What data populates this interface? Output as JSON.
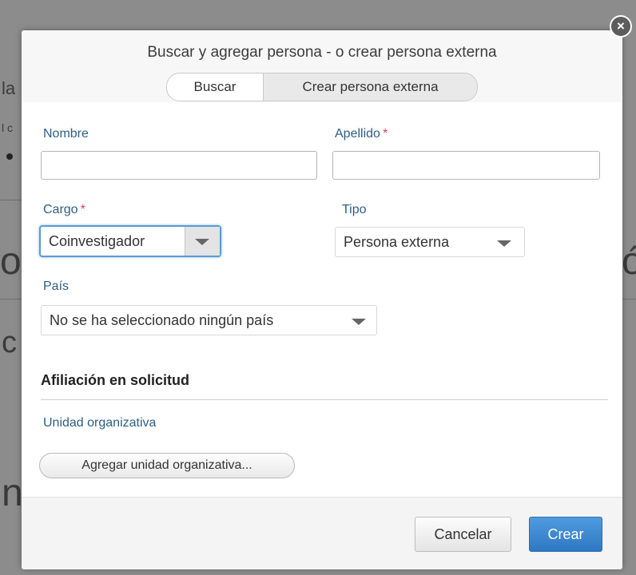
{
  "background": {
    "fragments": [
      "la",
      "l c",
      "o",
      "ó",
      "c",
      "n"
    ]
  },
  "dialog": {
    "title": "Buscar y agregar persona - o crear persona externa",
    "close_glyph": "×",
    "tabs": [
      {
        "label": "Buscar",
        "active": true
      },
      {
        "label": "Crear persona externa",
        "active": false
      }
    ]
  },
  "form": {
    "nombre": {
      "label": "Nombre",
      "value": "",
      "required": false
    },
    "apellido": {
      "label": "Apellido",
      "value": "",
      "required": true,
      "required_mark": "*"
    },
    "cargo": {
      "label": "Cargo",
      "selected": "Coinvestigador",
      "required": true,
      "required_mark": "*"
    },
    "tipo": {
      "label": "Tipo",
      "selected": "Persona externa"
    },
    "pais": {
      "label": "País",
      "selected": "No se ha seleccionado ningún país"
    }
  },
  "affiliation": {
    "section_title": "Afiliación en solicitud",
    "unit_label": "Unidad organizativa",
    "add_unit_button": "Agregar unidad organizativa..."
  },
  "footer": {
    "cancel_label": "Cancelar",
    "create_label": "Crear"
  },
  "colors": {
    "label": "#2d5e86",
    "required": "#e0405a",
    "primary_button": "#3b86d0",
    "focus_ring": "#5b9bd5"
  }
}
